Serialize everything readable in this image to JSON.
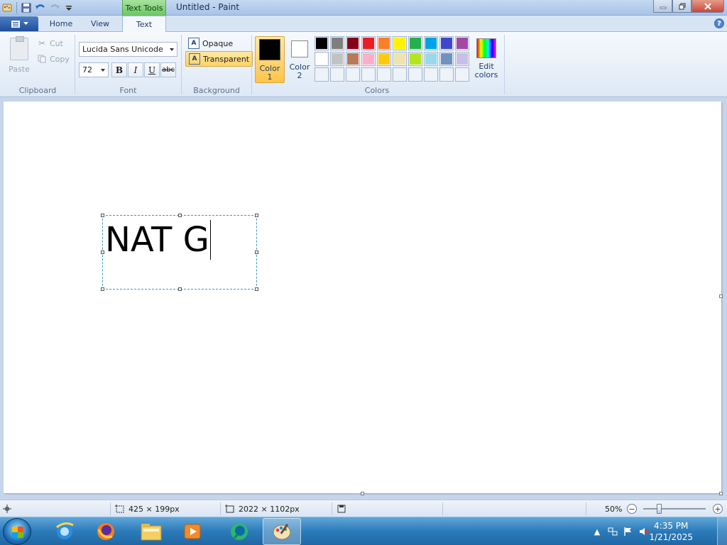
{
  "window": {
    "context_tab": "Text Tools",
    "title": "Untitled - Paint"
  },
  "tabs": {
    "home": "Home",
    "view": "View",
    "text": "Text"
  },
  "clipboard": {
    "paste": "Paste",
    "cut": "Cut",
    "copy": "Copy",
    "group": "Clipboard"
  },
  "font": {
    "family": "Lucida Sans Unicode",
    "size": "72",
    "bold": "B",
    "italic": "I",
    "underline": "U",
    "strikethrough": "abc",
    "group": "Font"
  },
  "background": {
    "opaque": "Opaque",
    "transparent": "Transparent",
    "group": "Background"
  },
  "colors": {
    "color1_line1": "Color",
    "color1_line2": "1",
    "color2_line1": "Color",
    "color2_line2": "2",
    "color1_value": "#000000",
    "color2_value": "#ffffff",
    "edit_line1": "Edit",
    "edit_line2": "colors",
    "group": "Colors",
    "palette_row1": [
      "#000000",
      "#7f7f7f",
      "#880015",
      "#ed1c24",
      "#ff7f27",
      "#fff200",
      "#22b14c",
      "#00a2e8",
      "#3f48cc",
      "#a349a4"
    ],
    "palette_row2": [
      "#ffffff",
      "#c3c3c3",
      "#b97a57",
      "#ffaec9",
      "#ffc90e",
      "#efe4b0",
      "#b5e61d",
      "#99d9ea",
      "#7092be",
      "#c8bfe7"
    ]
  },
  "canvas": {
    "text": "NAT G"
  },
  "status": {
    "selection_size": "425 × 199px",
    "image_size": "2022 × 1102px",
    "zoom": "50%"
  },
  "taskbar": {
    "time": "4:35 PM",
    "date": "1/21/2025"
  }
}
